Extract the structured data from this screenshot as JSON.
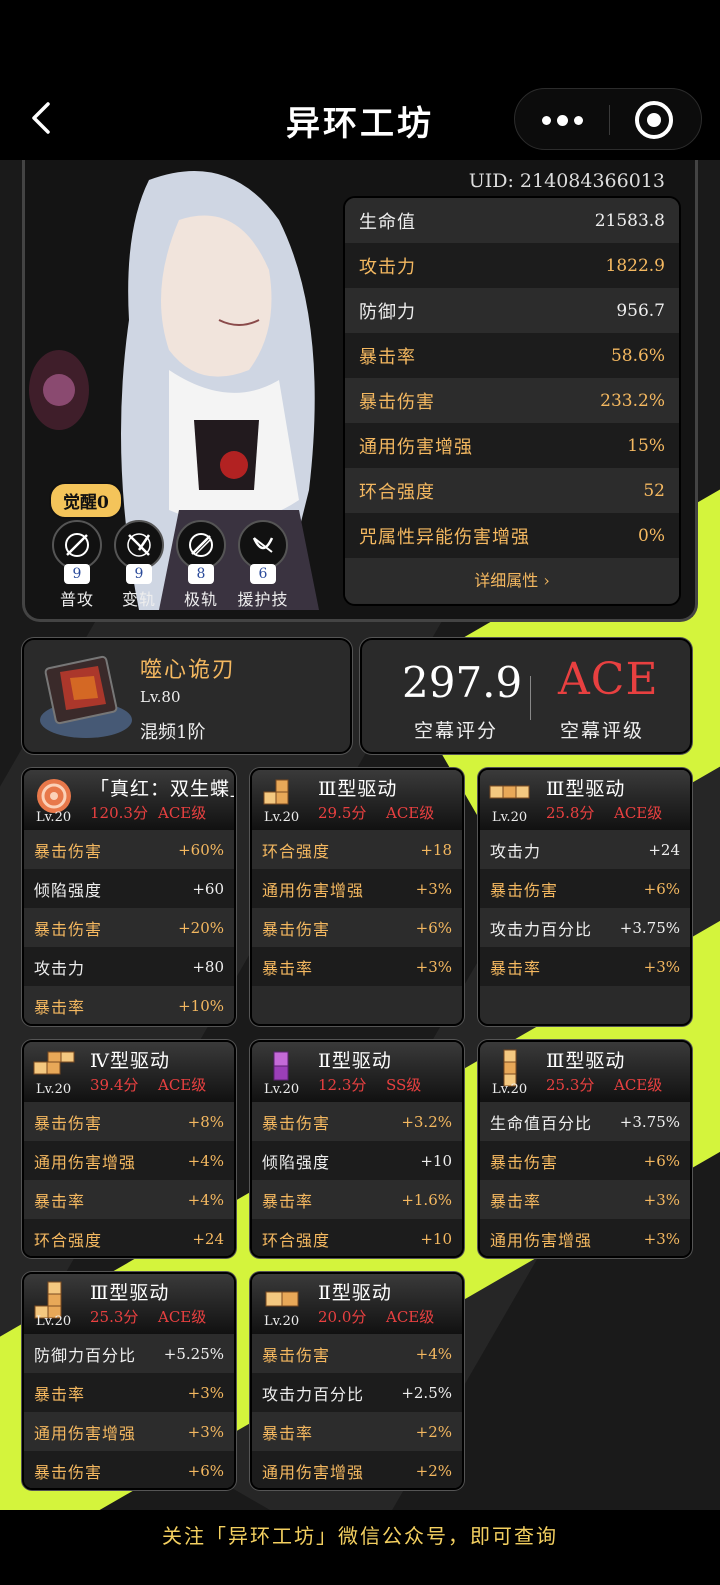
{
  "header": {
    "title": "异环工坊"
  },
  "character": {
    "uid": "UID: 214084366013",
    "awaken": "觉醒0",
    "skills": [
      {
        "level": "9",
        "name": "普攻"
      },
      {
        "level": "9",
        "name": "变轨"
      },
      {
        "level": "8",
        "name": "极轨"
      },
      {
        "level": "6",
        "name": "援护技"
      }
    ],
    "stats": [
      {
        "label": "生命值",
        "value": "21583.8"
      },
      {
        "label": "攻击力",
        "value": "1822.9"
      },
      {
        "label": "防御力",
        "value": "956.7"
      },
      {
        "label": "暴击率",
        "value": "58.6%"
      },
      {
        "label": "暴击伤害",
        "value": "233.2%"
      },
      {
        "label": "通用伤害增强",
        "value": "15%"
      },
      {
        "label": "环合强度",
        "value": "52"
      },
      {
        "label": "咒属性异能伤害增强",
        "value": "0%"
      }
    ],
    "more_label": "详细属性 ›"
  },
  "weapon": {
    "name": "噬心诡刃",
    "level": "Lv.80",
    "refine": "混频1阶"
  },
  "score": {
    "value": "297.9",
    "value_label": "空幕评分",
    "grade": "ACE",
    "grade_label": "空幕评级"
  },
  "discs": [
    {
      "name": "「真红：双生蝶」",
      "level": "Lv.20",
      "score": "120.3分",
      "grade": "ACE级",
      "rows": [
        [
          "暴击伤害",
          "+60%"
        ],
        [
          "倾陷强度",
          "+60"
        ],
        [
          "暴击伤害",
          "+20%"
        ],
        [
          "攻击力",
          "+80"
        ],
        [
          "暴击率",
          "+10%"
        ]
      ]
    },
    {
      "name": "Ⅲ型驱动",
      "level": "Lv.20",
      "score": "29.5分",
      "grade": "ACE级",
      "rows": [
        [
          "环合强度",
          "+18"
        ],
        [
          "通用伤害增强",
          "+3%"
        ],
        [
          "暴击伤害",
          "+6%"
        ],
        [
          "暴击率",
          "+3%"
        ]
      ]
    },
    {
      "name": "Ⅲ型驱动",
      "level": "Lv.20",
      "score": "25.8分",
      "grade": "ACE级",
      "rows": [
        [
          "攻击力",
          "+24"
        ],
        [
          "暴击伤害",
          "+6%"
        ],
        [
          "攻击力百分比",
          "+3.75%"
        ],
        [
          "暴击率",
          "+3%"
        ]
      ]
    },
    {
      "name": "Ⅳ型驱动",
      "level": "Lv.20",
      "score": "39.4分",
      "grade": "ACE级",
      "rows": [
        [
          "暴击伤害",
          "+8%"
        ],
        [
          "通用伤害增强",
          "+4%"
        ],
        [
          "暴击率",
          "+4%"
        ],
        [
          "环合强度",
          "+24"
        ]
      ]
    },
    {
      "name": "Ⅱ型驱动",
      "level": "Lv.20",
      "score": "12.3分",
      "grade": "SS级",
      "rows": [
        [
          "暴击伤害",
          "+3.2%"
        ],
        [
          "倾陷强度",
          "+10"
        ],
        [
          "暴击率",
          "+1.6%"
        ],
        [
          "环合强度",
          "+10"
        ]
      ]
    },
    {
      "name": "Ⅲ型驱动",
      "level": "Lv.20",
      "score": "25.3分",
      "grade": "ACE级",
      "rows": [
        [
          "生命值百分比",
          "+3.75%"
        ],
        [
          "暴击伤害",
          "+6%"
        ],
        [
          "暴击率",
          "+3%"
        ],
        [
          "通用伤害增强",
          "+3%"
        ]
      ]
    },
    {
      "name": "Ⅲ型驱动",
      "level": "Lv.20",
      "score": "25.3分",
      "grade": "ACE级",
      "rows": [
        [
          "防御力百分比",
          "+5.25%"
        ],
        [
          "暴击率",
          "+3%"
        ],
        [
          "通用伤害增强",
          "+3%"
        ],
        [
          "暴击伤害",
          "+6%"
        ]
      ]
    },
    {
      "name": "Ⅱ型驱动",
      "level": "Lv.20",
      "score": "20.0分",
      "grade": "ACE级",
      "rows": [
        [
          "暴击伤害",
          "+4%"
        ],
        [
          "攻击力百分比",
          "+2.5%"
        ],
        [
          "暴击率",
          "+2%"
        ],
        [
          "通用伤害增强",
          "+2%"
        ]
      ]
    }
  ],
  "footer": {
    "text": "关注「异环工坊」微信公众号，即可查询"
  },
  "colors": {
    "accent_gold": "#f4b860",
    "grade_red": "#e84040",
    "lime": "#d4f43c"
  }
}
